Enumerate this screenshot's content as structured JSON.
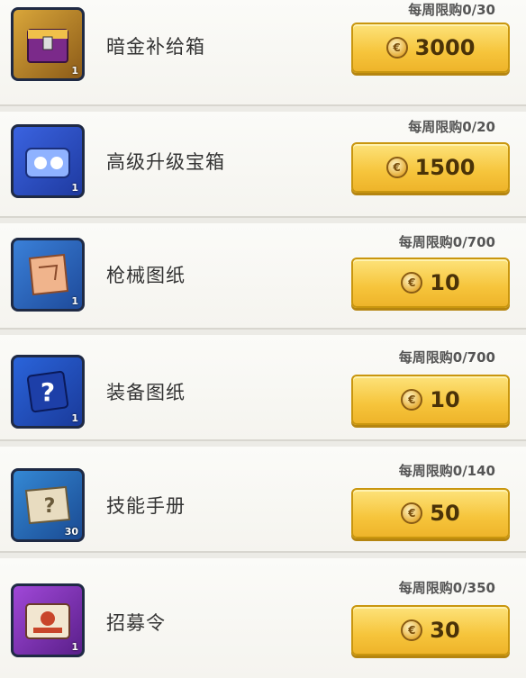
{
  "items": [
    {
      "name": "暗金补给箱",
      "limit": "每周限购0/30",
      "price": "3000",
      "badge": "",
      "icon": "gold-supply-crate-icon",
      "icon_bg": "#c7902a",
      "icon_fg": "#7b2a8a"
    },
    {
      "name": "高级升级宝箱",
      "limit": "每周限购0/20",
      "price": "1500",
      "badge": "",
      "icon": "blue-upgrade-chest-icon",
      "icon_bg": "#2a4fd2",
      "icon_fg": "#8fb2ff"
    },
    {
      "name": "枪械图纸",
      "limit": "每周限购0/700",
      "price": "10",
      "badge": "",
      "icon": "weapon-blueprint-icon",
      "icon_bg": "#2a6fc8",
      "icon_fg": "#f0b48c"
    },
    {
      "name": "装备图纸",
      "limit": "每周限购0/700",
      "price": "10",
      "badge": "",
      "icon": "equipment-blueprint-icon",
      "icon_bg": "#2a5bd0",
      "icon_fg": "#1d3fa8"
    },
    {
      "name": "技能手册",
      "limit": "每周限购0/140",
      "price": "50",
      "badge": "30",
      "icon": "skill-manual-scroll-icon",
      "icon_bg": "#2a7ec8",
      "icon_fg": "#e8dcc0"
    },
    {
      "name": "招募令",
      "limit": "每周限购0/350",
      "price": "30",
      "badge": "",
      "icon": "recruit-order-icon",
      "icon_bg": "#8a38c2",
      "icon_fg": "#c8452a"
    }
  ]
}
